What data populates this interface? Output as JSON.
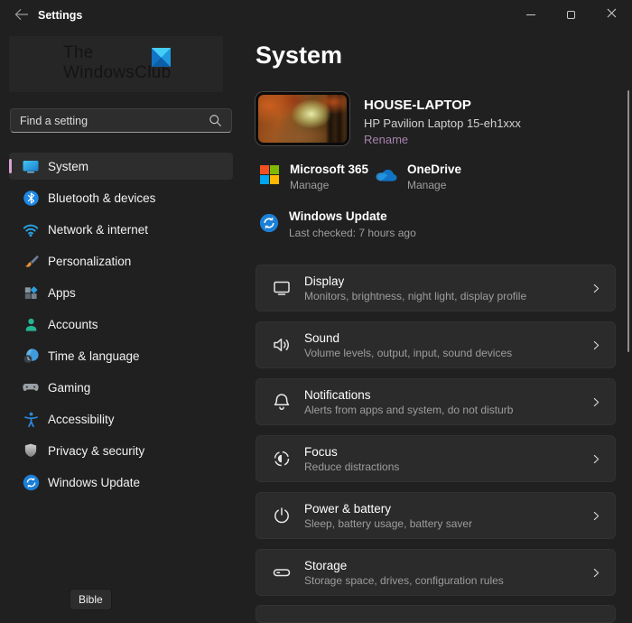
{
  "titlebar": {
    "title": "Settings"
  },
  "logo": {
    "line1": "The",
    "line2": "WindowsClub"
  },
  "search": {
    "placeholder": "Find a setting"
  },
  "sidebar": {
    "items": [
      {
        "label": "System",
        "icon": "system-monitor-icon",
        "selected": true
      },
      {
        "label": "Bluetooth & devices",
        "icon": "bluetooth-icon"
      },
      {
        "label": "Network & internet",
        "icon": "wifi-icon"
      },
      {
        "label": "Personalization",
        "icon": "paintbrush-icon"
      },
      {
        "label": "Apps",
        "icon": "apps-grid-icon"
      },
      {
        "label": "Accounts",
        "icon": "person-icon"
      },
      {
        "label": "Time & language",
        "icon": "clock-globe-icon"
      },
      {
        "label": "Gaming",
        "icon": "gamepad-icon"
      },
      {
        "label": "Accessibility",
        "icon": "accessibility-person-icon"
      },
      {
        "label": "Privacy & security",
        "icon": "shield-icon"
      },
      {
        "label": "Windows Update",
        "icon": "update-sync-icon"
      }
    ]
  },
  "main": {
    "page_title": "System",
    "device": {
      "name": "HOUSE-LAPTOP",
      "model": "HP Pavilion Laptop 15-eh1xxx",
      "rename_link": "Rename"
    },
    "quick_links": [
      {
        "title": "Microsoft 365",
        "action": "Manage",
        "icon": "microsoft-logo-icon"
      },
      {
        "title": "OneDrive",
        "action": "Manage",
        "icon": "onedrive-cloud-icon"
      }
    ],
    "windows_update": {
      "title": "Windows Update",
      "status": "Last checked: 7 hours ago",
      "icon": "update-sync-icon"
    },
    "cards": [
      {
        "title": "Display",
        "subtitle": "Monitors, brightness, night light, display profile",
        "icon": "display-icon"
      },
      {
        "title": "Sound",
        "subtitle": "Volume levels, output, input, sound devices",
        "icon": "speaker-icon"
      },
      {
        "title": "Notifications",
        "subtitle": "Alerts from apps and system, do not disturb",
        "icon": "bell-icon"
      },
      {
        "title": "Focus",
        "subtitle": "Reduce distractions",
        "icon": "focus-moon-icon"
      },
      {
        "title": "Power & battery",
        "subtitle": "Sleep, battery usage, battery saver",
        "icon": "power-icon"
      },
      {
        "title": "Storage",
        "subtitle": "Storage space, drives, configuration rules",
        "icon": "storage-drive-icon"
      }
    ]
  },
  "tooltip": {
    "label": "Bible"
  },
  "colors": {
    "window_bg": "#202020",
    "card_bg": "#2b2b2b",
    "accent_pill": "#d9a2d4",
    "link": "#a583ad",
    "update_blue": "#1b7fd6"
  }
}
